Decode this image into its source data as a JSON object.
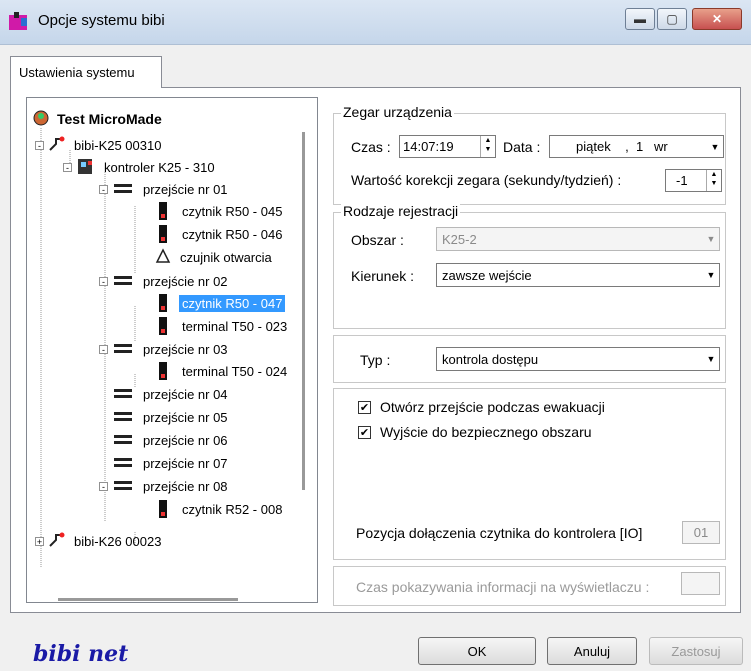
{
  "window": {
    "title": "Opcje systemu bibi"
  },
  "tabs": [
    {
      "label": "Ustawienia systemu"
    }
  ],
  "tree": {
    "root": "Test MicroMade",
    "items": [
      {
        "label": "bibi-K25 00310",
        "expander": "-"
      },
      {
        "label": "kontroler K25 - 310",
        "expander": "-"
      },
      {
        "label": "przejście nr 01",
        "expander": "-"
      },
      {
        "label": "czytnik R50 - 045"
      },
      {
        "label": "czytnik R50 - 046"
      },
      {
        "label": "czujnik otwarcia"
      },
      {
        "label": "przejście nr 02",
        "expander": "-"
      },
      {
        "label": "czytnik R50 - 047",
        "selected": true
      },
      {
        "label": "terminal T50 - 023"
      },
      {
        "label": "przejście nr 03",
        "expander": "-"
      },
      {
        "label": "terminal T50 - 024"
      },
      {
        "label": "przejście nr 04"
      },
      {
        "label": "przejście nr 05"
      },
      {
        "label": "przejście nr 06"
      },
      {
        "label": "przejście nr 07"
      },
      {
        "label": "przejście nr 08",
        "expander": "-"
      },
      {
        "label": "czytnik R52 - 008"
      },
      {
        "label": "bibi-K26 00023",
        "expander": "+"
      }
    ]
  },
  "clock": {
    "legend": "Zegar urządzenia",
    "time_label": "Czas :",
    "time_value": "14:07:19",
    "date_label": "Data :",
    "date_value": "piątek    ,  1   wr",
    "correction_label": "Wartość korekcji zegara (sekundy/tydzień) :",
    "correction_value": "-1"
  },
  "registration": {
    "legend": "Rodzaje rejestracji",
    "area_label": "Obszar :",
    "area_value": "K25-2",
    "direction_label": "Kierunek :",
    "direction_value": "zawsze wejście"
  },
  "type": {
    "label": "Typ :",
    "value": "kontrola dostępu"
  },
  "options": [
    {
      "label": "Otwórz przejście podczas ewakuacji",
      "checked": true
    },
    {
      "label": "Wyjście do bezpiecznego obszaru",
      "checked": true
    }
  ],
  "position": {
    "label": "Pozycja dołączenia czytnika do kontrolera [IO]",
    "value": "01"
  },
  "display_time": {
    "label": "Czas pokazywania informacji na wyświetlaczu :",
    "value": ""
  },
  "footer": {
    "logo": "bibi net",
    "ok": "OK",
    "cancel": "Anuluj",
    "apply": "Zastosuj"
  },
  "icons": [
    "app-icon",
    "minimize-icon",
    "maximize-icon",
    "close-icon",
    "globe-icon",
    "network-icon",
    "controller-icon",
    "gate-icon",
    "reader-icon",
    "bell-icon"
  ]
}
